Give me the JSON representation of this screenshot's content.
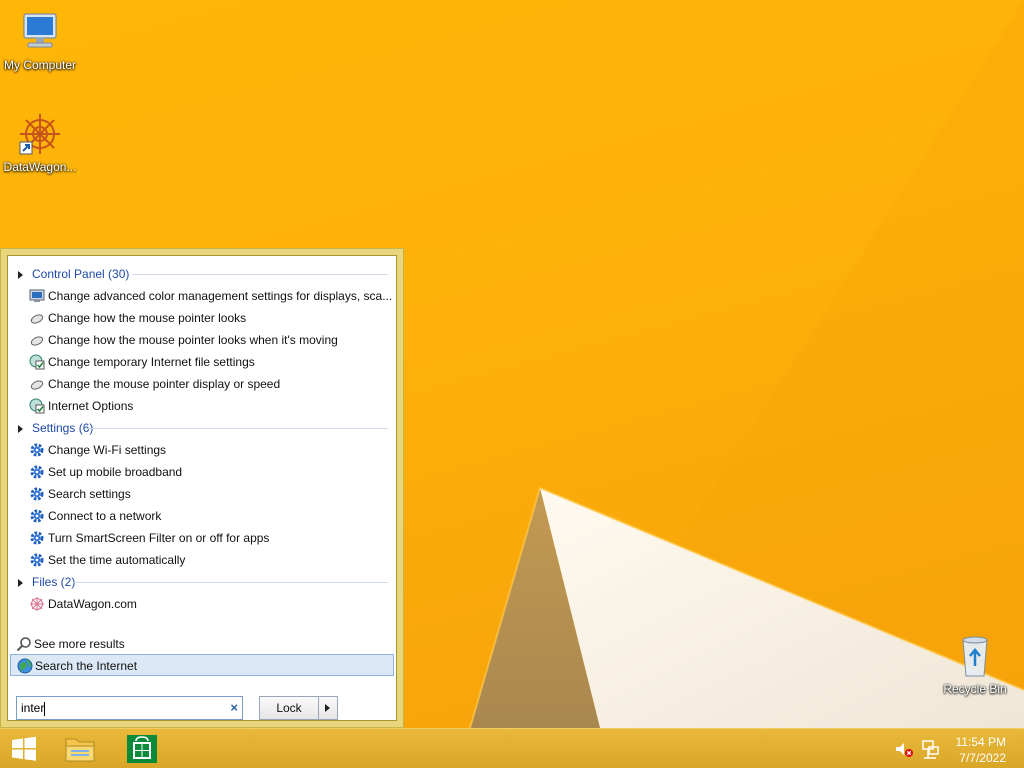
{
  "desktop": {
    "icons": [
      {
        "label": "My Computer",
        "icon": "computer-icon"
      },
      {
        "label": "DataWagon...",
        "icon": "datawagon-icon"
      },
      {
        "label": "Recycle Bin",
        "icon": "recycle-bin-icon"
      }
    ]
  },
  "start_menu": {
    "groups": [
      {
        "title": "Control Panel (30)",
        "items": [
          {
            "label": "Change advanced color management settings for displays, sca...",
            "icon": "monitor-icon"
          },
          {
            "label": "Change how the mouse pointer looks",
            "icon": "mouse-icon"
          },
          {
            "label": "Change how the mouse pointer looks when it's moving",
            "icon": "mouse-icon"
          },
          {
            "label": "Change temporary Internet file settings",
            "icon": "internet-options-icon"
          },
          {
            "label": "Change the mouse pointer display or speed",
            "icon": "mouse-icon"
          },
          {
            "label": "Internet Options",
            "icon": "internet-options-icon"
          }
        ]
      },
      {
        "title": "Settings (6)",
        "items": [
          {
            "label": "Change Wi-Fi settings",
            "icon": "gear-icon"
          },
          {
            "label": "Set up mobile broadband",
            "icon": "gear-icon"
          },
          {
            "label": "Search settings",
            "icon": "gear-icon"
          },
          {
            "label": "Connect to a network",
            "icon": "gear-icon"
          },
          {
            "label": "Turn SmartScreen Filter on or off for apps",
            "icon": "gear-icon"
          },
          {
            "label": "Set the time automatically",
            "icon": "gear-icon"
          }
        ]
      },
      {
        "title": "Files (2)",
        "items": [
          {
            "label": "DataWagon.com",
            "icon": "datawagon-file-icon"
          }
        ]
      }
    ],
    "see_more": "See more results",
    "search_internet": "Search the Internet",
    "search_value": "inter",
    "lock_label": "Lock"
  },
  "taskbar": {
    "time": "11:54 PM",
    "date": "7/7/2022"
  },
  "colors": {
    "wallpaper": "#fdb10a",
    "group_title": "#1f4aa8",
    "selected_bg": "#dde8f6"
  }
}
